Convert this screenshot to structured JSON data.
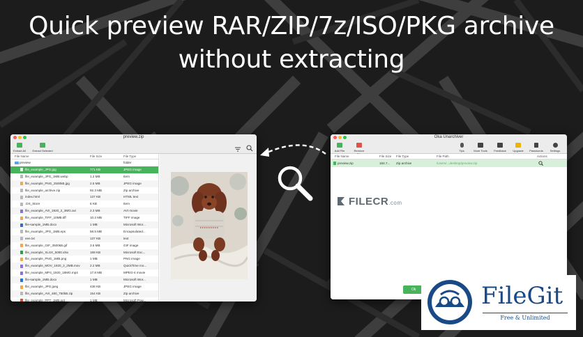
{
  "headline": {
    "line1": "Quick preview RAR/ZIP/7z/ISO/PKG archive",
    "line2": "without extracting"
  },
  "left_window": {
    "title": "preview.zip",
    "toolbar": {
      "extract_all": "Extract All",
      "extract_selected": "Extract Selected"
    },
    "columns": [
      "File Name",
      "File Size",
      "File Type"
    ],
    "rows": [
      {
        "name": "preview",
        "size": "",
        "type": "folder",
        "kind": "folder",
        "indent": 0
      },
      {
        "name": "file_example_JPG.jpg",
        "size": "771 KB",
        "type": "JPEG image",
        "kind": "image",
        "indent": 1,
        "selected": true
      },
      {
        "name": "file_example_JPG_1MB.webp",
        "size": "1.2 MB",
        "type": "Item",
        "kind": "doc",
        "indent": 1
      },
      {
        "name": "file_example_PNG_2500kB.jpg",
        "size": "2.5 MB",
        "type": "JPEG image",
        "kind": "image",
        "indent": 1
      },
      {
        "name": "file_example_archive.zip",
        "size": "92.3 MB",
        "type": "Zip archive",
        "kind": "doc",
        "indent": 1
      },
      {
        "name": "index.html",
        "size": "137 KB",
        "type": "HTML text",
        "kind": "doc",
        "indent": 1
      },
      {
        "name": ".DS_Store",
        "size": "6 KB",
        "type": "Item",
        "kind": "doc",
        "indent": 1
      },
      {
        "name": "file_example_AVI_1920_2_3MG.avi",
        "size": "2.3 MB",
        "type": "AVI movie",
        "kind": "movie",
        "indent": 1
      },
      {
        "name": "file_example_TIFF_10MB.tiff",
        "size": "10.2 MB",
        "type": "TIFF image",
        "kind": "image",
        "indent": 1
      },
      {
        "name": "file-sample_1MB.docx",
        "size": "1 MB",
        "type": "Microsoft Wor...",
        "kind": "word",
        "indent": 1
      },
      {
        "name": "file_example_JPG_1MB.eps",
        "size": "58.5 MB",
        "type": "Encapsulated...",
        "kind": "doc",
        "indent": 1
      },
      {
        "name": "eee.txt",
        "size": "137 KB",
        "type": "text",
        "kind": "doc",
        "indent": 1
      },
      {
        "name": "file_example_GIF_3500kB.gif",
        "size": "3.6 MB",
        "type": "GIF image",
        "kind": "image",
        "indent": 1
      },
      {
        "name": "file_example_XLSX_5000.xlsx",
        "size": "189 KB",
        "type": "Microsoft Exc...",
        "kind": "excel",
        "indent": 1
      },
      {
        "name": "file_example_PNG_1MB.png",
        "size": "1 MB",
        "type": "PNG image",
        "kind": "image",
        "indent": 1
      },
      {
        "name": "file_example_MOV_1920_2_2MB.mov",
        "size": "2.2 MB",
        "type": "QuickTime mo...",
        "kind": "movie",
        "indent": 1
      },
      {
        "name": "file_example_MP4_1920_18MG.mp4",
        "size": "17.8 MB",
        "type": "MPEG-4 movie",
        "kind": "movie",
        "indent": 1
      },
      {
        "name": "file-sample_1MB.docx",
        "size": "1 MB",
        "type": "Microsoft Wor...",
        "kind": "word",
        "indent": 1
      },
      {
        "name": "file_example_JPG.jpeg",
        "size": "438 KB",
        "type": "JPEG image",
        "kind": "image",
        "indent": 1
      },
      {
        "name": "file_example_AVI_480_750kB.zip",
        "size": "154 KB",
        "type": "Zip archive",
        "kind": "doc",
        "indent": 1
      },
      {
        "name": "file_example_PPT_1MB.ppt",
        "size": "1 MB",
        "type": "Microsoft Pow...",
        "kind": "ppt",
        "indent": 1
      }
    ]
  },
  "right_window": {
    "title": "Oka Unarchiver",
    "toolbar_left": [
      {
        "label": "Add File",
        "icon": "add-file-icon"
      },
      {
        "label": "Remove File",
        "icon": "remove-file-icon"
      }
    ],
    "toolbar_right": [
      {
        "label": "Tips",
        "icon": "lightbulb-icon"
      },
      {
        "label": "More Tools",
        "icon": "grid-icon"
      },
      {
        "label": "Feedback",
        "icon": "chat-icon"
      },
      {
        "label": "Upgrade",
        "icon": "crown-icon"
      },
      {
        "label": "Passwords",
        "icon": "lock-icon"
      },
      {
        "label": "Settings",
        "icon": "gear-icon"
      }
    ],
    "columns": [
      "File Name",
      "File Size",
      "File Type",
      "File Path",
      "Actions"
    ],
    "row": {
      "name": "preview.zip",
      "size": "184.7...",
      "type": "Zip archive",
      "path": "/Users/...desktop/preview.zip"
    },
    "bottom_button": "Ok"
  },
  "watermark": {
    "brand": "FILECR",
    "suffix": ".com"
  },
  "logo": {
    "name": "FileGit",
    "tagline": "Free & Unlimited"
  },
  "colors": {
    "accent": "#47b35a",
    "logo_blue": "#1a4a86"
  }
}
